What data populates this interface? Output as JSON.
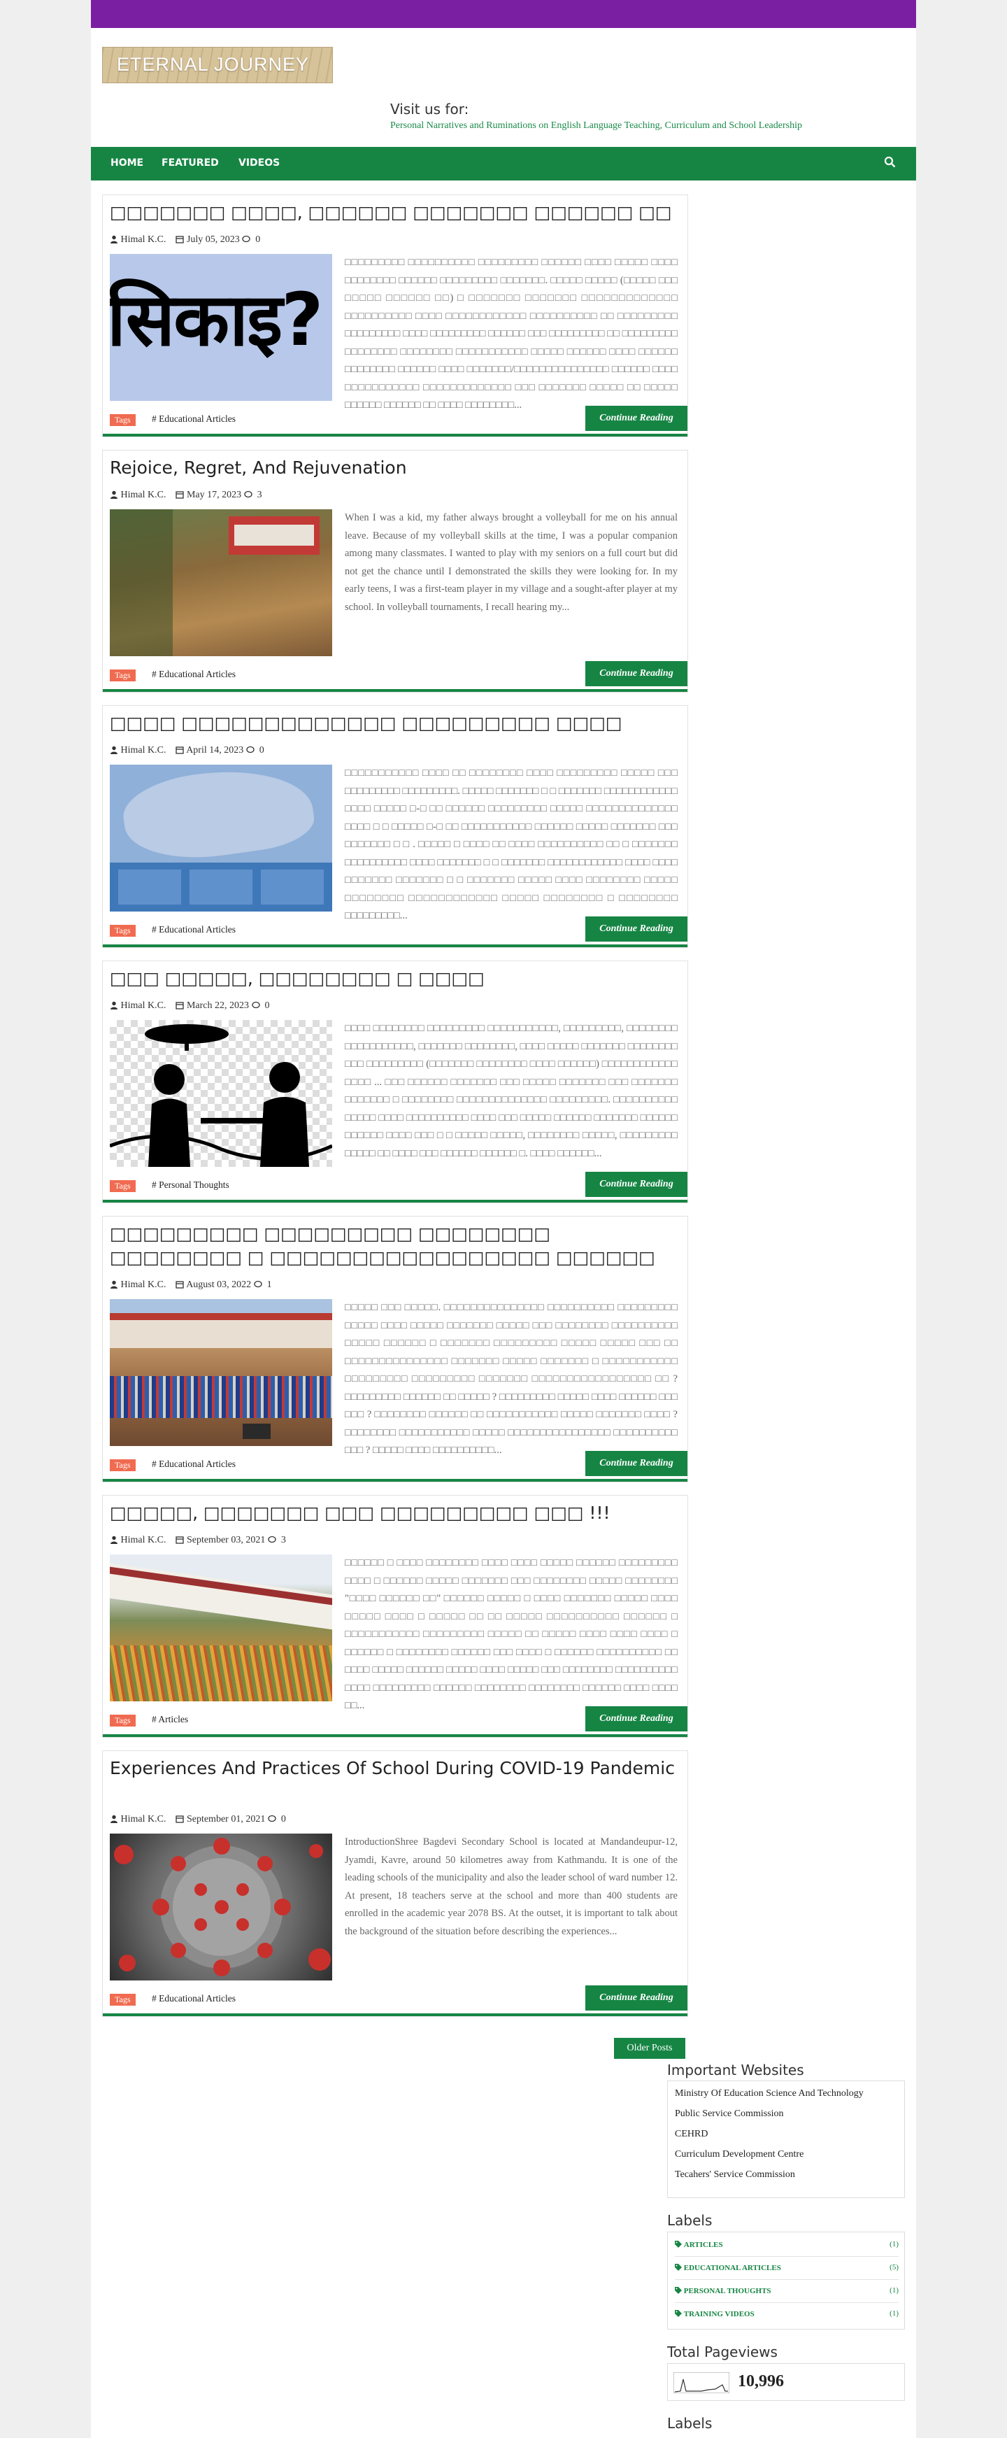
{
  "site": {
    "logo_text": "ETERNAL JOURNEY",
    "visit_label": "Visit us for:",
    "tagline": "Personal Narratives and Ruminations on English Language Teaching, Curriculum and School Leadership"
  },
  "nav": {
    "items": [
      "HOME",
      "FEATURED",
      "VIDEOS"
    ]
  },
  "posts": [
    {
      "title": "□□□□□□□ □□□□, □□□□□□ □□□□□□□ □□□□□□ □□",
      "author": "Himal K.C.",
      "date": "July 05, 2023",
      "comments": "0",
      "excerpt": "□□□□□□□□□ □□□□□□□□□□ □□□□□□□□□ □□□□□□ □□□□ □□□□□ □□□□ □□□□□□□□ □□□□□□ □□□□□□□□□ □□□□□□□. □□□□□ □□□□□ (□□□□□ □□□ □□□□□ □□□□□□ □□) □ □□□□□□□ □□□□□□□ □□□□□□□□□□□□□ □□□□□□□□□□ □□□□ □□□□□□□□□□□□ □□□□□□□□□□ □□ □□□□□□□□□ □□□□□□□□□ □□□□ □□□□□□□□□ □□□□□□ □□□ □□□□□□□□□ □□ □□□□□□□□□ □□□□□□□□ □□□□□□□□ □□□□□□□□□□□ □□□□□ □□□□□□ □□□□ □□□□□□ □□□□□□□□ □□□□□□ □□□□ □□□□□□□/□□□□□□□□□□□□□□□ □□□□□□ □□□□ □□□□□□□□□□□ □□□□□□□□□□□□□ □□□ □□□□□□□ □□□□□ □□ □□□□□ □□□□□□ □□□□□□ □□ □□□□ □□□□□□□□...",
      "tag": "# Educational Articles"
    },
    {
      "title": "Rejoice, Regret, And Rejuvenation",
      "author": "Himal K.C.",
      "date": "May 17, 2023",
      "comments": "3",
      "excerpt": "When I was a kid, my father always brought a volleyball for me on his annual leave. Because of my volleyball skills at the time, I was a popular companion among many classmates. I wanted to play with my seniors on a full court but did not get the chance until I demonstrated the skills they were looking for. In my early teens, I was a first-team player in my village and a sought-after player at my school. In volleyball tournaments, I recall hearing my...",
      "tag": "# Educational Articles"
    },
    {
      "title": "□□□□ □□□□□□□□□□□□□ □□□□□□□□□ □□□□",
      "author": "Himal K.C.",
      "date": "April 14, 2023",
      "comments": "0",
      "excerpt": "□□□□□□□□□□□ □□□□ □□ □□□□□□□□ □□□□ □□□□□□□□□ □□□□□ □□□ □□□□□□□□□ □□□□□□□□□. □□□□□ □□□□□□□ □ □ □□□□□□□ □□□□□□□□□□□□ □□□□ □□□□□ □-□ □□ □□□□□□ □□□□□□□□□ □□□□□ □□□□□□□□□□□□□□ □□□□ □ □ □□□□□ □-□ □□ □□□□□□□□□□□ □□□□□□ □□□□□ □□□□□□□ □□□ □□□□□□□ □ □ . □□□□□ □ □□□□ □□ □□□□ □□□□□□□□□□ □□ □ □□□□□□□ □□□□□□□□□□ □□□□ □□□□□□□ □ □ □□□□□□□ □□□□□□□□□□□□ □□□□ □□□□ □□□□□□□ □□□□□□□ □ □ □□□□□□□ □□□□□ □□□□ □□□□□□□□ □□□□□ □□□□□□□□ □□□□□□□□□□□□ □□□□□ □□□□□□□□ □ □□□□□□□□ □□□□□□□□□...",
      "tag": "# Educational Articles"
    },
    {
      "title": "□□□ □□□□□, □□□□□□□□ □ □□□□",
      "author": "Himal K.C.",
      "date": "March 22, 2023",
      "comments": "0",
      "excerpt": "□□□□ □□□□□□□□ □□□□□□□□□ □□□□□□□□□□□, □□□□□□□□□, □□□□□□□□ □□□□□□□□□□□, □□□□□□□ □□□□□□□□, □□□□ □□□□□ □□□□□□□ □□□□□□□□ □□□ □□□□□□□□□ (□□□□□□□ □□□□□□□□ □□□□ □□□□□□) □□□□□□□□□□□□ □□□□ ... □□□ □□□□□□ □□□□□□□ □□□ □□□□□ □□□□□□□ □□□ □□□□□□□ □□□□□□□ □ □□□□□□□□ □□□□□□□□□□□□□□ □□□□□□□□□. □□□□□□□□□□ □□□□□ □□□□ □□□□□□□□□□ □□□□ □□□ □□□□□ □□□□□□ □□□□□□□ □□□□□□ □□□□□□ □□□□ □□□ □ □ □□□□□ □□□□□, □□□□□□□□ □□□□□, □□□□□□□□□ □□□□□ □□ □□□□ □□□ □□□□□□ □□□□□□ □. □□□□ □□□□□□...",
      "tag": "# Personal Thoughts"
    },
    {
      "title": "□□□□□□□□□ □□□□□□□□□ □□□□□□□□ □□□□□□□□ □ □□□□□□□□□□□□□□□□□ □□□□□□",
      "author": "Himal K.C.",
      "date": "August 03, 2022",
      "comments": "1",
      "excerpt": "□□□□□ □□□ □□□□□. □□□□□□□□□□□□□□□ □□□□□□□□□□ □□□□□□□□□ □□□□□ □□□□ □□□□□ □□□□□□□ □□□□□ □□□ □□□□□□□□ □□□□□□□□□□ □□□□□ □□□□□□ □ □□□□□□□ □□□□□□□□□ □□□□□ □□□□□ □□□ □□ □□□□□□□□□□□□□□□ □□□□□□□ □□□□□ □□□□□□□ □ □□□□□□□□□□□ □□□□□□□□□ □□□□□□□□□ □□□□□□□ □□□□□□□□□□□□□□□□□ □□ ? □□□□□□□□□ □□□□□□ □□ □□□□□ ? □□□□□□□□□ □□□□□ □□□□ □□□□□□ □□□ □□□ ? □□□□□□□□ □□□□□□ □□ □□□□□□□□□□□ □□□□□ □□□□□□□ □□□□ ? □□□□□□□□ □□□□□□□□□□□ □□□□□ □□□□□□□□□□□□□□□□ □□□□□□□□□□ □□□ ? □□□□□ □□□□ □□□□□□□□□□...",
      "tag": "# Educational Articles"
    },
    {
      "title": "□□□□□, □□□□□□□ □□□ □□□□□□□□□ □□□ !!!",
      "author": "Himal K.C.",
      "date": "September 03, 2021",
      "comments": "3",
      "excerpt": "□□□□□□ □ □□□□ □□□□□□□□ □□□□ □□□□ □□□□□ □□□□□□ □□□□□□□□□ □□□□ □ □□□□□□ □□□□□ □□□□□□□ □□□ □□□□□□□□ □□□□□ □□□□□□□□ \"□□□□ □□□□□□ □□\" □□□□□□ □□□□□ □ □□□□ □□□□□□□ □□□□□ □□□□ □□□□□ □□□□ □ □□□□□ □□ □□ □□□□□ □□□□□□□□□□ □□□□□□ □ □□□□□□□□□□□ □□□□□□□□□ □□□□□ □□ □□□□□ □□□□ □□□□ □□□□ □ □□□□□□ □ □□□□□□□□ □□□□□□ □□□ □□□□ □ □□□□□□ □□□□□□□□□□ □□ □□□□ □□□□□ □□□□□□ □□□□□ □□□□ □□□□□ □□□ □□□□□□□□ □□□□□□□□□□ □□□□ □□□□□□□□□ □□□□□□ □□□□□□□□ □□□□□□□□ □□□□□□ □□□□ □□□□ □□...",
      "tag": "# Articles"
    },
    {
      "title": "Experiences And Practices Of School During COVID-19 Pandemic",
      "author": "Himal K.C.",
      "date": "September 01, 2021",
      "comments": "0",
      "excerpt": "IntroductionShree Bagdevi Secondary School is located at Mandandeupur-12, Jyamdi, Kavre, around 50 kilometres away from Kathmandu. It is one of the leading schools of the municipality and also the leader school of ward number 12. At present, 18 teachers serve at the school and more than 400 students are enrolled in the academic year 2078 BS. At the outset, it is important to talk about the background of the situation before describing the experiences...",
      "tag": "# Educational Articles"
    }
  ],
  "thumbs": {
    "sikai_text": "सिकाइ?"
  },
  "post_footer": {
    "tags_label": "Tags",
    "continue_label": "Continue Reading"
  },
  "pagination": {
    "older_label": "Older Posts"
  },
  "sidebar": {
    "websites_title": "Important Websites",
    "websites": [
      "Ministry Of Education Science And Technology",
      "Public Service Commission",
      "CEHRD",
      "Curriculum Development Centre",
      "Tecahers' Service Commission"
    ],
    "labels_title": "Labels",
    "labels": [
      {
        "name": "ARTICLES",
        "count": "(1)"
      },
      {
        "name": "EDUCATIONAL ARTICLES",
        "count": "(5)"
      },
      {
        "name": "PERSONAL THOUGHTS",
        "count": "(1)"
      },
      {
        "name": "TRAINING VIDEOS",
        "count": "(1)"
      }
    ],
    "pageviews_title": "Total Pageviews",
    "pageviews": "10,996",
    "labels2_title": "Labels"
  },
  "colors": {
    "purple": "#7b1fa2",
    "green": "#168544",
    "orange": "#f06b50"
  }
}
